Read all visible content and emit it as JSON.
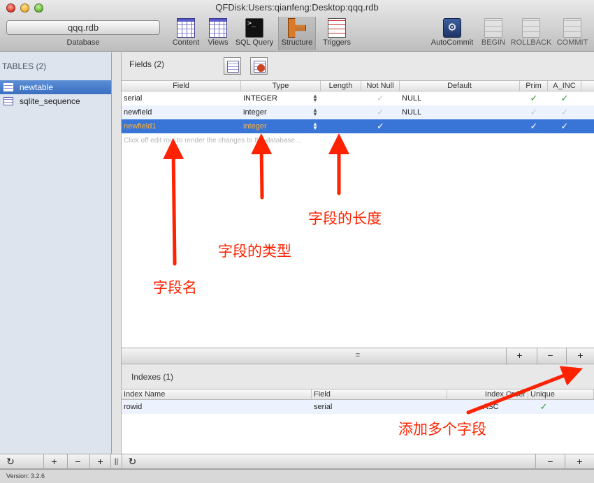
{
  "window": {
    "title": "QFDisk:Users:qianfeng:Desktop:qqq.rdb"
  },
  "toolbar": {
    "database_value": "qqq.rdb",
    "database_label": "Database",
    "items": [
      {
        "label": "Content",
        "icon": "grid-icon"
      },
      {
        "label": "Views",
        "icon": "grid-icon"
      },
      {
        "label": "SQL Query",
        "icon": "terminal-icon"
      },
      {
        "label": "Structure",
        "icon": "structure-icon"
      },
      {
        "label": "Triggers",
        "icon": "triggers-icon"
      },
      {
        "label": "AutoCommit",
        "icon": "gear-icon"
      },
      {
        "label": "BEGIN",
        "icon": "begin-icon"
      },
      {
        "label": "ROLLBACK",
        "icon": "rollback-icon"
      },
      {
        "label": "COMMIT",
        "icon": "commit-icon"
      }
    ]
  },
  "sidebar": {
    "header": "TABLES (2)",
    "items": [
      {
        "label": "newtable",
        "selected": true
      },
      {
        "label": "sqlite_sequence",
        "selected": false
      }
    ]
  },
  "fields": {
    "title": "Fields (2)",
    "columns": [
      "Field",
      "Type",
      "Length",
      "Not Null",
      "Default",
      "Prim",
      "A_INC"
    ],
    "rows": [
      {
        "field": "serial",
        "type": "INTEGER",
        "length": "",
        "not_null": "grey",
        "default": "NULL",
        "prim": "green",
        "a_inc": "green"
      },
      {
        "field": "newfield",
        "type": "integer",
        "length": "",
        "not_null": "grey",
        "default": "NULL",
        "prim": "grey",
        "a_inc": "grey"
      },
      {
        "field": "newfield1",
        "type": "integer",
        "length": "",
        "not_null": "white",
        "default": "",
        "prim": "white",
        "a_inc": "white"
      }
    ],
    "hint": "Click off edit row to render the changes to the database...",
    "bar_buttons": {
      "duplicate": "+",
      "remove": "−",
      "add": "+"
    }
  },
  "indexes": {
    "title": "Indexes (1)",
    "columns": [
      "Index Name",
      "Field",
      "Index Order",
      "Unique"
    ],
    "rows": [
      {
        "name": "rowid",
        "field": "serial",
        "order": "ASC",
        "unique": "green"
      }
    ]
  },
  "bottom_bar": {
    "refresh": "↻",
    "add_table_dup": "+",
    "remove": "−",
    "add": "+",
    "divider": "||",
    "refresh2": "↻",
    "idx_remove": "−",
    "idx_add": "+"
  },
  "status": {
    "version": "Version: 3.2.6"
  },
  "annotations": {
    "field_name": "字段名",
    "field_type": "字段的类型",
    "field_length": "字段的长度",
    "add_fields": "添加多个字段",
    "color": "#ff2200"
  },
  "glyphs": {
    "check": "✓",
    "updown": "▲▼",
    "grip": "≡"
  },
  "colors": {
    "selection": "#3875d7",
    "sidebar_bg": "#dde4ed",
    "check_green": "#2c9a2c",
    "orange_text": "#ffb23a"
  }
}
